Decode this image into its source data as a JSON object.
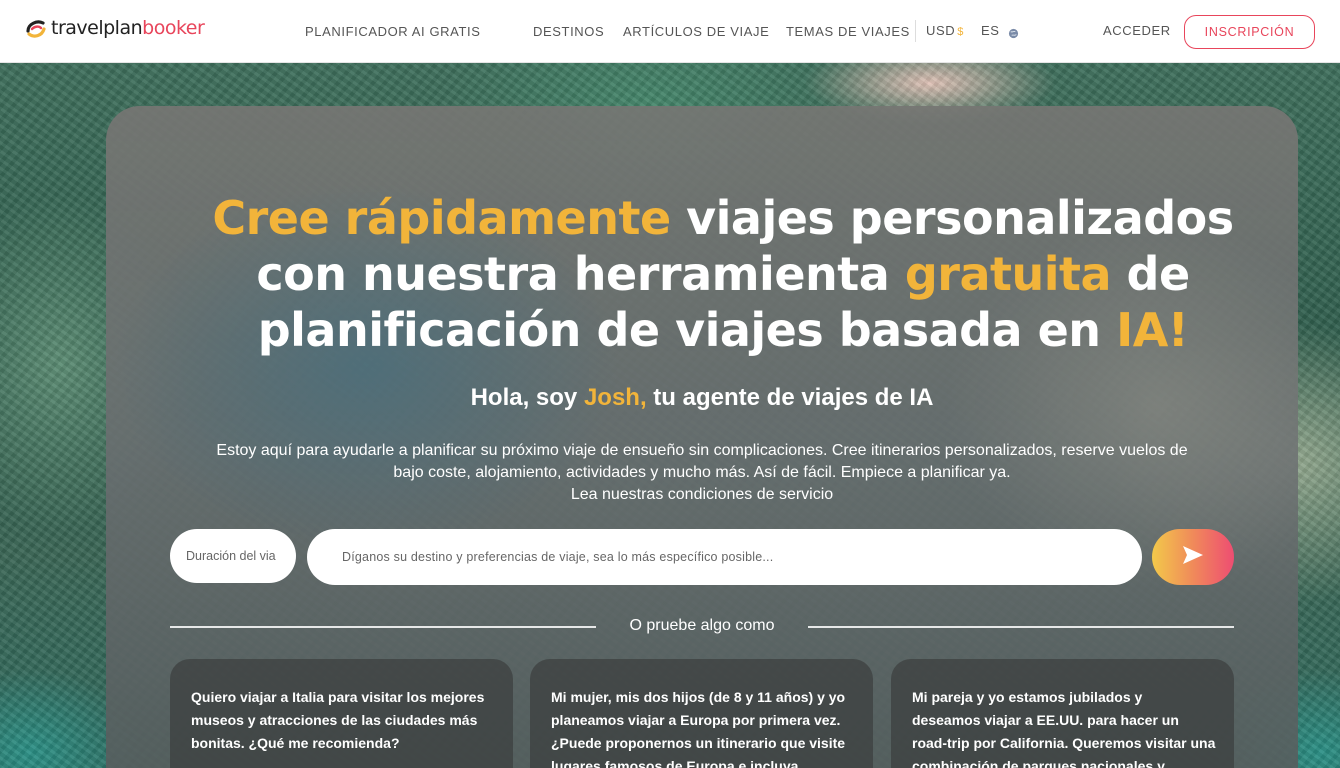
{
  "brand": {
    "name_part1": "travelplan",
    "name_part2": "booker"
  },
  "nav": {
    "planner": "PLANIFICADOR AI GRATIS",
    "destinations": "DESTINOS",
    "articles": "ARTÍCULOS DE VIAJE",
    "topics": "TEMAS DE VIAJES",
    "currency": "USD",
    "currency_symbol": "$",
    "language": "ES",
    "login": "ACCEDER",
    "signup": "INSCRIPCIÓN"
  },
  "hero": {
    "line1_a": "Cree rápidamente",
    "line1_b": " viajes personalizados",
    "line2_a": "con nuestra herramienta ",
    "line2_b": "gratuita",
    "line2_c": " de",
    "line3_a": "planificación de viajes basada en ",
    "line3_b": "IA!"
  },
  "greeting": {
    "pre": "Hola, soy ",
    "name": "Josh,",
    "post": " tu agente de viajes de IA"
  },
  "description": {
    "line1": "Estoy aquí para ayudarle a planificar su próximo viaje de ensueño sin complicaciones. Cree itinerarios personalizados, reserve vuelos de",
    "line2": "bajo coste, alojamiento, actividades y mucho más. Así de fácil. Empiece a planificar ya.",
    "terms_link": "Lea nuestras condiciones de servicio"
  },
  "form": {
    "duration_placeholder": "Duración del viaje",
    "duration_visible": "Duración del via",
    "prompt_placeholder": "Díganos su destino y preferencias de viaje, sea lo más específico posible..."
  },
  "suggest": {
    "label": "O pruebe algo como",
    "cards": [
      {
        "lines": [
          "Quiero viajar a Italia para visitar los mejores",
          "museos y atracciones de las ciudades más",
          "bonitas. ¿Qué me recomienda?"
        ]
      },
      {
        "lines": [
          "Mi mujer, mis dos hijos (de 8 y 11 años) y yo",
          "planeamos viajar a Europa por primera vez.",
          "¿Puede proponernos un itinerario que visite",
          "lugares famosos de Europa e incluya"
        ]
      },
      {
        "lines": [
          "Mi pareja y yo estamos jubilados y",
          "deseamos viajar a EE.UU. para hacer un",
          "road-trip por California. Queremos visitar una",
          "combinación de parques nacionales y"
        ]
      }
    ]
  },
  "colors": {
    "accent_yellow": "#f2b43a",
    "brand_red": "#e8455b"
  }
}
